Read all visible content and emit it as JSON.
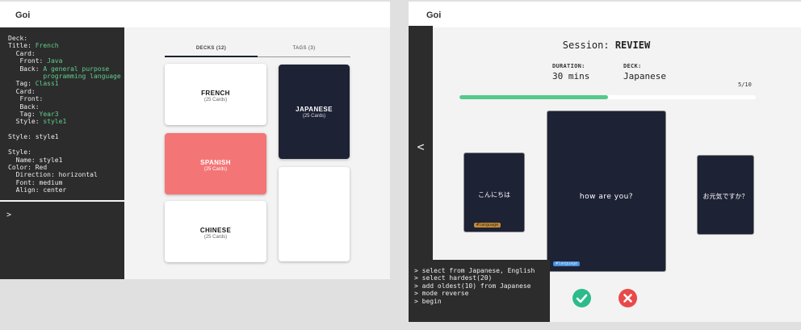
{
  "app_title": "Goi",
  "editor": {
    "lines": [
      {
        "k": "Deck:",
        "v": ""
      },
      {
        "k": "Title: ",
        "v": "French"
      },
      {
        "k": "  Card:",
        "v": ""
      },
      {
        "k": "   Front: ",
        "v": "Java"
      },
      {
        "k": "   Back: ",
        "v": "A general purpose"
      },
      {
        "k": "         ",
        "v": "programming language"
      },
      {
        "k": "  Tag: ",
        "v": "Class1"
      },
      {
        "k": "  Card:",
        "v": ""
      },
      {
        "k": "   Front:",
        "v": ""
      },
      {
        "k": "   Back:",
        "v": ""
      },
      {
        "k": "   Tag: ",
        "v": "Year3"
      },
      {
        "k": "  Style: ",
        "v": "style1"
      },
      {
        "k": "",
        "v": ""
      },
      {
        "k": "Style: style1",
        "v": ""
      },
      {
        "k": "",
        "v": ""
      },
      {
        "k": "Style:",
        "v": ""
      },
      {
        "k": "  Name: style1",
        "v": ""
      },
      {
        "k": "Color: Red",
        "v": ""
      },
      {
        "k": "  Direction: horizontal",
        "v": ""
      },
      {
        "k": "  Font: medium",
        "v": ""
      },
      {
        "k": "  Align: center",
        "v": ""
      }
    ],
    "prompt": ">"
  },
  "tabs": [
    {
      "label": "DECKS (12)",
      "active": true
    },
    {
      "label": "TAGS (3)",
      "active": false
    }
  ],
  "decks": {
    "french": {
      "name": "FRENCH",
      "count": "(25 Cards)"
    },
    "spanish": {
      "name": "SPANISH",
      "count": "(25 Cards)"
    },
    "chinese": {
      "name": "CHINESE",
      "count": "(25 Cards)"
    },
    "japanese": {
      "name": "JAPANESE",
      "count": "(25 Cards)"
    }
  },
  "session": {
    "prefix": "Session: ",
    "mode": "REVIEW",
    "duration_label": "DURATION:",
    "duration_value": "30 mins",
    "deck_label": "DECK:",
    "deck_value": "Japanese",
    "progress_text": "5/10",
    "progress_fraction": 0.5,
    "back_symbol": "<"
  },
  "cards": {
    "left": {
      "text": "こんにちは",
      "tag": "#language"
    },
    "center": {
      "text": "how are you?",
      "tag": "#language"
    },
    "right": {
      "text": "お元気ですか？"
    }
  },
  "terminal": [
    "> select from Japanese, English",
    "> select hardest(20)",
    "> add oldest(10) from Japanese",
    "> mode reverse",
    "> begin"
  ],
  "colors": {
    "navy": "#1e2235",
    "accent_green": "#55c98a",
    "red_deck": "#f47575",
    "ok": "#2cbb8a",
    "no": "#e84a4a"
  }
}
